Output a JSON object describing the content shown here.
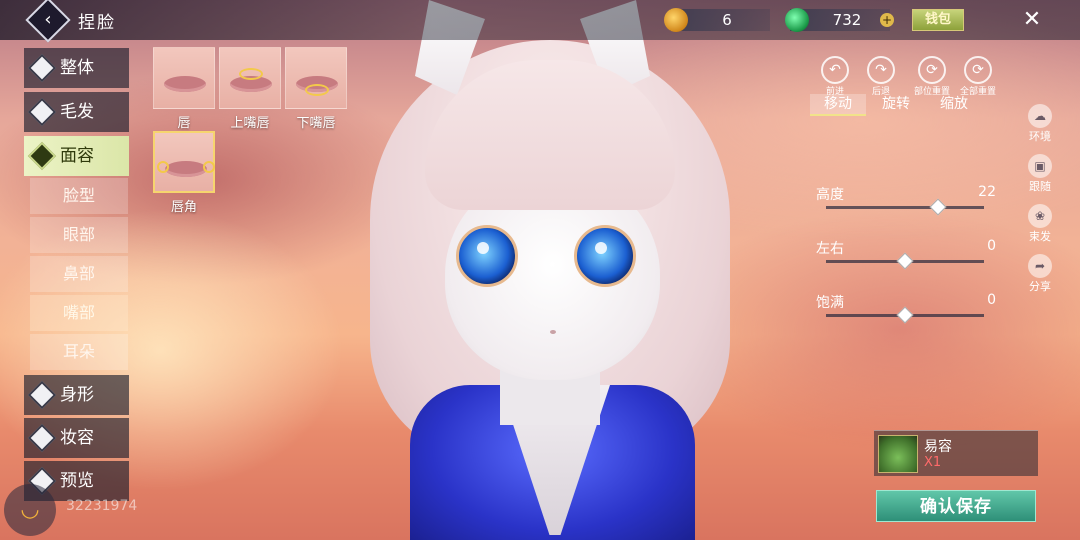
{
  "header": {
    "title": "捏脸",
    "currency_gold": "6",
    "currency_jade": "732",
    "wallet_label": "钱包",
    "close_label": "✕",
    "back_label": "‹"
  },
  "menu": {
    "items": [
      {
        "label": "整体",
        "icon": "body-icon"
      },
      {
        "label": "毛发",
        "icon": "hair-icon"
      },
      {
        "label": "面容",
        "icon": "face-icon"
      },
      {
        "label": "身形",
        "icon": "figure-icon"
      },
      {
        "label": "妆容",
        "icon": "makeup-icon"
      },
      {
        "label": "预览",
        "icon": "preview-icon"
      }
    ],
    "sub_items": [
      "脸型",
      "眼部",
      "鼻部",
      "嘴部",
      "耳朵"
    ]
  },
  "lip_options": [
    {
      "label": "唇"
    },
    {
      "label": "上嘴唇"
    },
    {
      "label": "下嘴唇"
    },
    {
      "label": "唇角"
    }
  ],
  "tools": [
    {
      "label": "前进",
      "icon": "undo-icon"
    },
    {
      "label": "后退",
      "icon": "redo-icon"
    },
    {
      "label": "部位重置",
      "icon": "part-reset-icon"
    },
    {
      "label": "全部重置",
      "icon": "all-reset-icon"
    }
  ],
  "mode_tabs": [
    "移动",
    "旋转",
    "缩放"
  ],
  "sliders": [
    {
      "label": "高度",
      "value": 22
    },
    {
      "label": "左右",
      "value": 0
    },
    {
      "label": "饱满",
      "value": 0
    }
  ],
  "side_tools": [
    {
      "label": "环境",
      "icon": "environment-icon"
    },
    {
      "label": "跟随",
      "icon": "camera-follow-icon"
    },
    {
      "label": "束发",
      "icon": "hair-tie-icon"
    },
    {
      "label": "分享",
      "icon": "share-icon"
    }
  ],
  "item": {
    "name": "易容",
    "count": "X1"
  },
  "confirm_label": "确认保存",
  "uid": "32231974",
  "colors": {
    "accent": "#dbe6a8",
    "confirm": "#2e8f78",
    "count": "#ff6a6a"
  }
}
